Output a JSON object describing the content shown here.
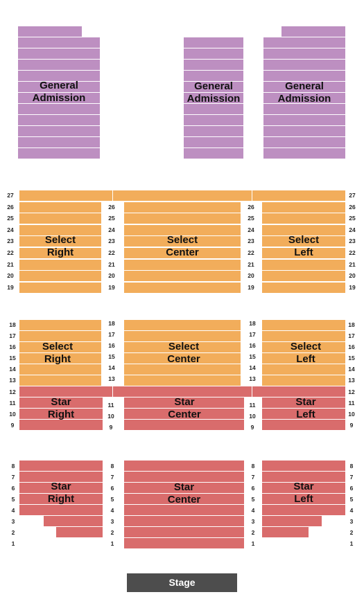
{
  "map": {
    "sections": {
      "ga_left": {
        "label_1": "General",
        "label_2": "Admission",
        "color": "#bd8fc1"
      },
      "ga_center": {
        "label_1": "General",
        "label_2": "Admission",
        "color": "#bd8fc1"
      },
      "ga_right": {
        "label_1": "General",
        "label_2": "Admission",
        "color": "#bd8fc1"
      },
      "select_upper_right": {
        "label_1": "Select",
        "label_2": "Right",
        "color": "#f2ad5b"
      },
      "select_upper_center": {
        "label_1": "Select",
        "label_2": "Center",
        "color": "#f2ad5b"
      },
      "select_upper_left": {
        "label_1": "Select",
        "label_2": "Left",
        "color": "#f2ad5b"
      },
      "select_lower_right": {
        "label_1": "Select",
        "label_2": "Right",
        "color": "#f2ad5b"
      },
      "select_lower_center": {
        "label_1": "Select",
        "label_2": "Center",
        "color": "#f2ad5b"
      },
      "select_lower_left": {
        "label_1": "Select",
        "label_2": "Left",
        "color": "#f2ad5b"
      },
      "star_upper_right": {
        "label_1": "Star",
        "label_2": "Right",
        "color": "#d96c6c"
      },
      "star_upper_center": {
        "label_1": "Star",
        "label_2": "Center",
        "color": "#d96c6c"
      },
      "star_upper_left": {
        "label_1": "Star",
        "label_2": "Left",
        "color": "#d96c6c"
      },
      "star_lower_right": {
        "label_1": "Star",
        "label_2": "Right",
        "color": "#d96c6c"
      },
      "star_lower_center": {
        "label_1": "Star",
        "label_2": "Center",
        "color": "#d96c6c"
      },
      "star_lower_left": {
        "label_1": "Star",
        "label_2": "Left",
        "color": "#d96c6c"
      }
    },
    "rows": {
      "upper_select": [
        "27",
        "26",
        "25",
        "24",
        "23",
        "22",
        "21",
        "20",
        "19"
      ],
      "lower_select": [
        "18",
        "17",
        "16",
        "15",
        "14",
        "13"
      ],
      "cross_aisle_row": "12",
      "upper_star": [
        "11",
        "10",
        "9"
      ],
      "lower_star": [
        "8",
        "7",
        "6",
        "5",
        "4",
        "3",
        "2",
        "1"
      ]
    },
    "stage_label": "Stage"
  }
}
